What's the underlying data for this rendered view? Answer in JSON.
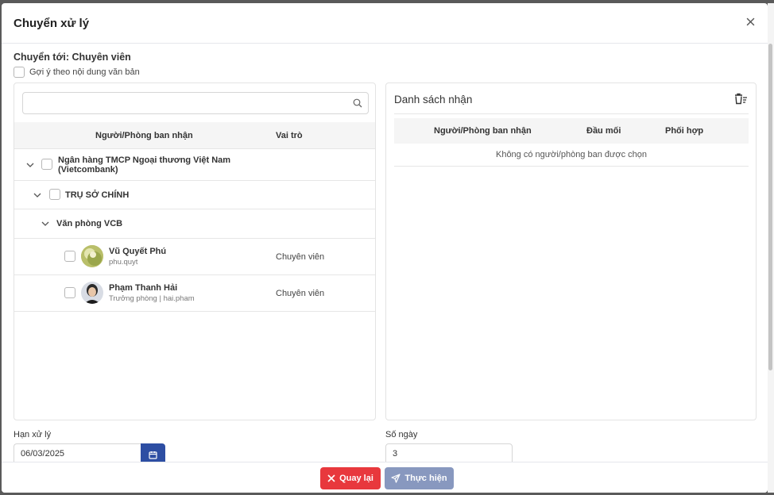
{
  "modal": {
    "title": "Chuyển xử lý",
    "subheading": "Chuyển tới: Chuyên viên",
    "suggest_label": "Gợi ý theo nội dung văn bản"
  },
  "left_panel": {
    "search_placeholder": "",
    "columns": {
      "recipient": "Người/Phòng ban nhận",
      "role": "Vai trò"
    },
    "tree": {
      "bank": "Ngân hàng TMCP Ngoại thương Việt Nam (Vietcombank)",
      "head_office": "TRỤ SỞ CHÍNH",
      "office": "Văn phòng VCB"
    },
    "people": [
      {
        "name": "Vũ Quyết Phú",
        "sub": "phu.quyt",
        "role": "Chuyên viên"
      },
      {
        "name": "Phạm Thanh Hải",
        "sub": "Trưởng phòng | hai.pham",
        "role": "Chuyên viên"
      }
    ]
  },
  "right_panel": {
    "title": "Danh sách nhận",
    "columns": {
      "recipient": "Người/Phòng ban nhận",
      "lead": "Đầu mối",
      "coordinate": "Phối hợp"
    },
    "empty_text": "Không có người/phòng ban được chọn"
  },
  "form": {
    "deadline_label": "Hạn xử lý",
    "deadline_value": "06/03/2025",
    "days_label": "Số ngày",
    "days_value": "3"
  },
  "footer": {
    "back_label": "Quay lại",
    "submit_label": "Thực hiện"
  },
  "colors": {
    "primary": "#2d4ea3",
    "danger": "#e8383d",
    "submit_disabled": "#8898bf"
  }
}
